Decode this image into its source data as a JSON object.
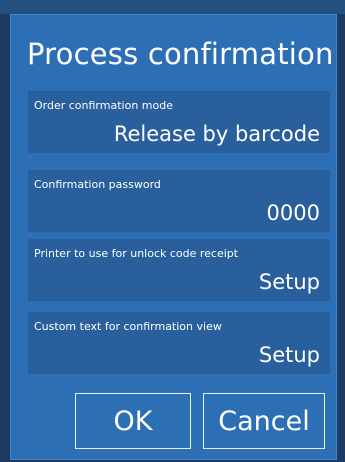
{
  "dialog": {
    "title": "Process confirmation",
    "fields": [
      {
        "label": "Order confirmation mode",
        "value": "Release by barcode"
      },
      {
        "label": "Confirmation password",
        "value": "0000"
      },
      {
        "label": "Printer to use for unlock code receipt",
        "value": "Setup"
      },
      {
        "label": "Custom text for confirmation view",
        "value": "Setup"
      }
    ],
    "ok_label": "OK",
    "cancel_label": "Cancel"
  },
  "colors": {
    "dialog_bg": "#2d6fb4",
    "field_bg": "#285f9c",
    "backdrop": "#1c3a62",
    "text": "#ffffff"
  }
}
